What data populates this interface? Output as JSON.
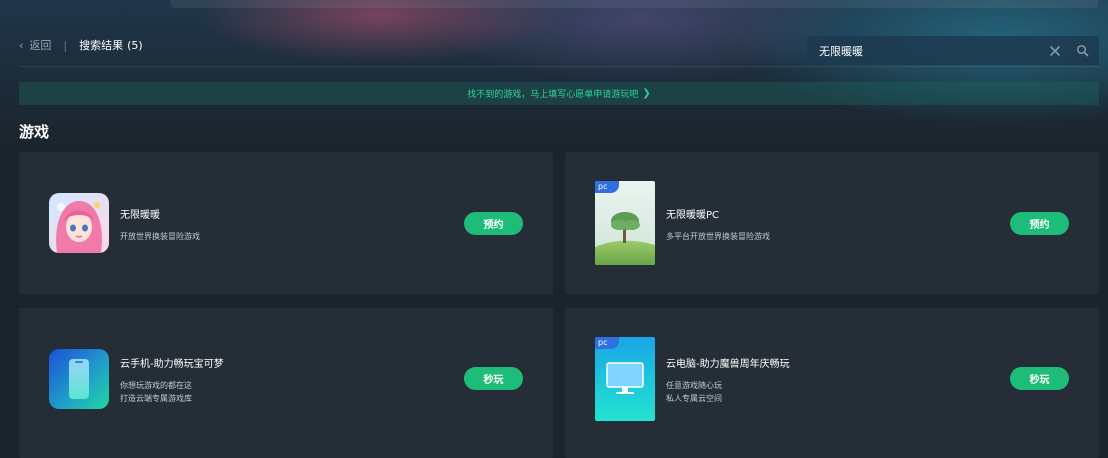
{
  "header": {
    "back_icon": "‹",
    "back_label": "返回",
    "separator": "|",
    "results_label": "搜索结果",
    "results_count": "(5)"
  },
  "search": {
    "value": "无限暖暖",
    "placeholder": "",
    "clear_icon": "close-icon",
    "search_icon": "search-icon"
  },
  "notice": {
    "text": "找不到的游戏，马上填写心愿单申请游玩吧",
    "arrow": "❯",
    "color": "#2ed39a"
  },
  "section": {
    "title": "游戏"
  },
  "games": [
    {
      "title": "无限暖暖",
      "desc": [
        "开放世界换装冒险游戏"
      ],
      "button": "预约",
      "badge": ""
    },
    {
      "title": "无限暖暖PC",
      "desc": [
        "多平台开放世界换装冒险游戏"
      ],
      "button": "预约",
      "badge": "pc"
    },
    {
      "title": "云手机-助力畅玩宝可梦",
      "desc": [
        "你想玩游戏的都在这",
        "打造云端专属游戏库"
      ],
      "button": "秒玩",
      "badge": ""
    },
    {
      "title": "云电脑-助力魔兽周年庆畅玩",
      "desc": [
        "任意游戏随心玩",
        "私人专属云空间"
      ],
      "button": "秒玩",
      "badge": "pc"
    }
  ],
  "colors": {
    "accent": "#1dbd79",
    "card": "#252e36",
    "background": "#1b232b",
    "pc_badge": "#2f6fe0"
  }
}
